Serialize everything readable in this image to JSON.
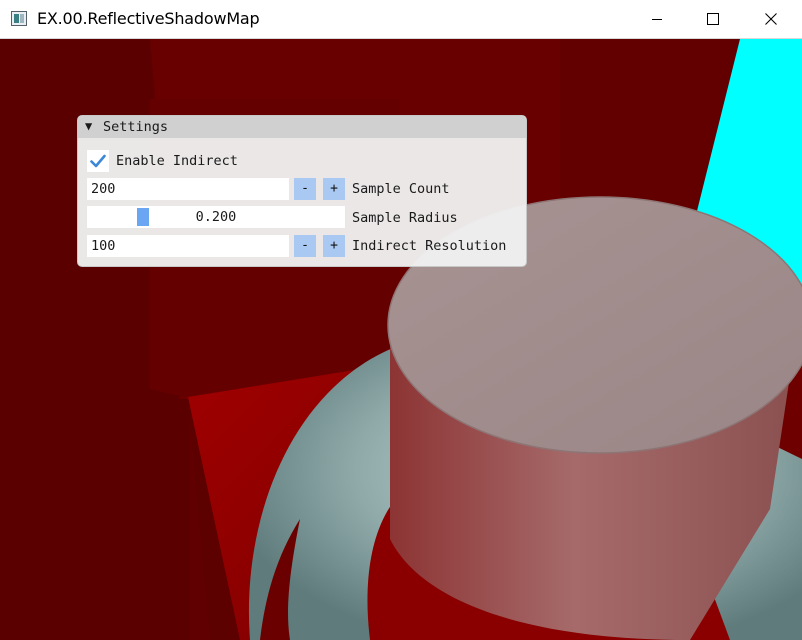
{
  "window": {
    "title": "EX.00.ReflectiveShadowMap",
    "icon": "app-window-icon",
    "controls": [
      "minimize-icon",
      "maximize-icon",
      "close-icon"
    ]
  },
  "settings": {
    "header": "Settings",
    "collapse_glyph": "▼",
    "enable_indirect": {
      "label": "Enable Indirect",
      "checked": true
    },
    "sample_count": {
      "value": "200",
      "label": "Sample Count",
      "minus": "-",
      "plus": "+"
    },
    "sample_radius": {
      "value": "0.200",
      "label": "Sample Radius",
      "fraction": 0.2
    },
    "indirect_resolution": {
      "value": "100",
      "label": "Indirect Resolution",
      "minus": "-",
      "plus": "+"
    }
  },
  "colors": {
    "checkmark": "#3d87d8",
    "stepper": "#a9c9f3",
    "slider_grab": "#6ba6f2",
    "wall_red": "#6b0000",
    "sky_cyan": "#00ffff"
  }
}
